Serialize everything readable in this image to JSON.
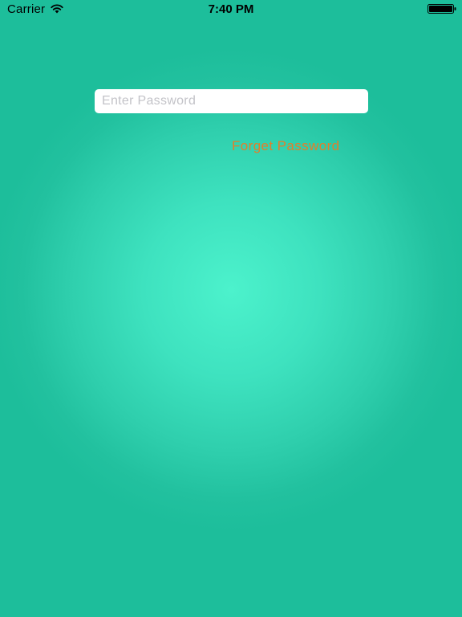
{
  "status_bar": {
    "carrier": "Carrier",
    "time": "7:40 PM",
    "wifi_icon": "wifi-icon",
    "battery_icon": "battery-full-icon",
    "battery_level": 1.0
  },
  "login": {
    "password_placeholder": "Enter Password",
    "password_value": "",
    "forget_password_label": "Forget Password"
  },
  "colors": {
    "background_edge": "#1dbe9b",
    "background_center": "#4cf2cc",
    "link": "#e57d29",
    "field_background": "#ffffff"
  }
}
